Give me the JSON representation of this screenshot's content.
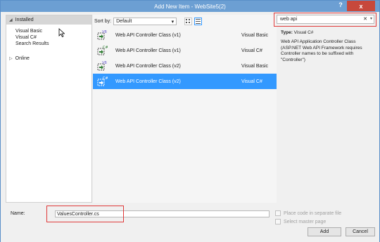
{
  "window": {
    "title": "Add New Item - WebSite5(2)",
    "help_label": "?",
    "close_label": "x"
  },
  "sidebar": {
    "installed_label": "Installed",
    "items": [
      {
        "label": "Visual Basic"
      },
      {
        "label": "Visual C#"
      },
      {
        "label": "Search Results"
      }
    ],
    "online_label": "Online"
  },
  "toolbar": {
    "sort_label": "Sort by:",
    "sort_value": "Default"
  },
  "templates": [
    {
      "name": "Web API Controller Class (v1)",
      "language": "Visual Basic",
      "icon": "vb-controller-icon"
    },
    {
      "name": "Web API Controller Class (v1)",
      "language": "Visual C#",
      "icon": "cs-controller-icon"
    },
    {
      "name": "Web API Controller Class (v2)",
      "language": "Visual Basic",
      "icon": "vb-controller-icon"
    },
    {
      "name": "Web API Controller Class (v2)",
      "language": "Visual C#",
      "icon": "cs-controller-icon",
      "selected": true
    }
  ],
  "search": {
    "value": "web api",
    "clear_label": "✕"
  },
  "details": {
    "type_label": "Type:",
    "type_value": "Visual C#",
    "description": "Web API Application Controller Class (ASP.NET Web API Framework requires Controller names to be suffixed with \"Controller\")"
  },
  "footer": {
    "name_label": "Name:",
    "name_value": "ValuesController.cs",
    "place_code_label": "Place code in separate file",
    "master_page_label": "Select master page",
    "add_label": "Add",
    "cancel_label": "Cancel"
  },
  "colors": {
    "titlebar": "#6c9fd3",
    "close_button": "#c7483c",
    "selection": "#3399ff",
    "highlight_outline": "#e03a3a"
  }
}
